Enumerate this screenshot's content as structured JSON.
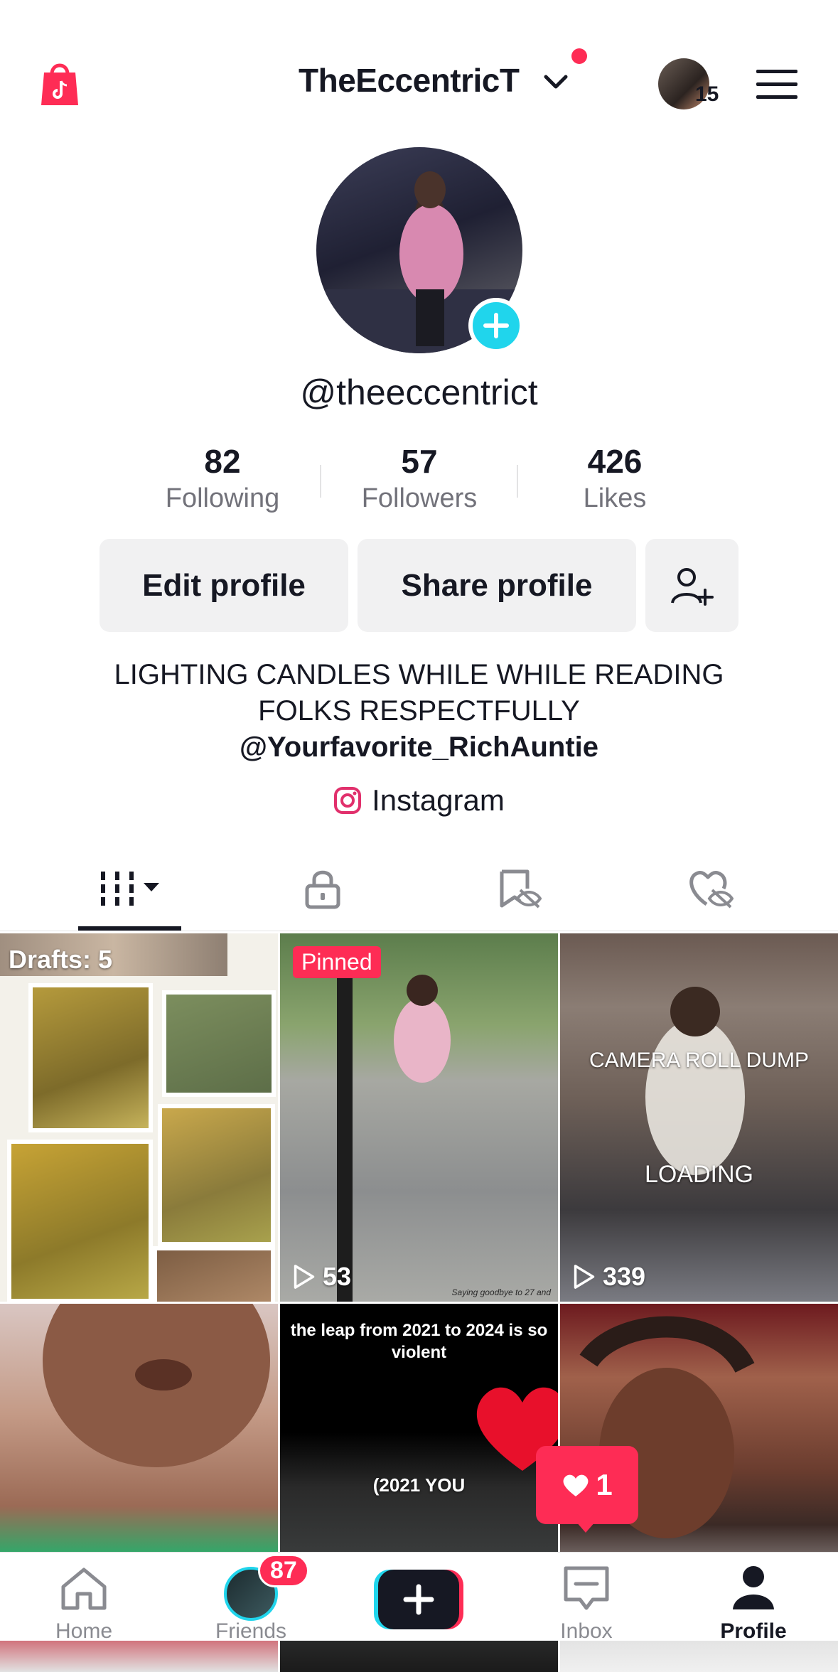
{
  "header": {
    "username": "TheEccentricT",
    "notification_count": "15"
  },
  "profile": {
    "handle": "@theeccentrict",
    "stats": [
      {
        "value": "82",
        "label": "Following"
      },
      {
        "value": "57",
        "label": "Followers"
      },
      {
        "value": "426",
        "label": "Likes"
      }
    ],
    "edit_label": "Edit profile",
    "share_label": "Share profile",
    "bio_line1": "LIGHTING CANDLES WHILE WHILE READING",
    "bio_line2": "FOLKS RESPECTFULLY",
    "bio_link": "@Yourfavorite_RichAuntie",
    "instagram_label": "Instagram"
  },
  "tabs": [
    {
      "icon": "grid-icon",
      "active": true
    },
    {
      "icon": "lock-icon",
      "active": false
    },
    {
      "icon": "repost-eye-off-icon",
      "active": false
    },
    {
      "icon": "heart-eye-off-icon",
      "active": false
    }
  ],
  "videos": [
    {
      "badge": "Drafts: 5"
    },
    {
      "badge": "Pinned",
      "views": "53",
      "caption": "Saying goodbye to 27 and"
    },
    {
      "views": "339",
      "overlay_top": "CAMERA ROLL DUMP",
      "overlay_bottom": "LOADING"
    },
    {},
    {
      "overlay_top": "the leap from 2021 to 2024 is so violent",
      "overlay_bottom": "(2021 YOU"
    },
    {}
  ],
  "like_popup": {
    "count": "1"
  },
  "bottom_nav": {
    "home": "Home",
    "friends": "Friends",
    "friends_badge": "87",
    "inbox": "Inbox",
    "profile": "Profile"
  },
  "colors": {
    "accent": "#fe2c55",
    "plus": "#20d5ec",
    "text": "#161823",
    "muted": "#72727a"
  }
}
